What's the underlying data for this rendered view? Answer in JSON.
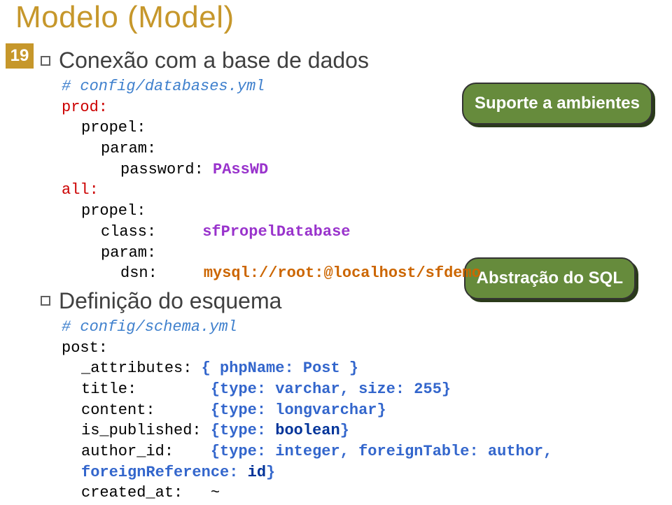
{
  "title": "Modelo (Model)",
  "slide_number": "19",
  "section1_heading": "Conexão com a base de dados",
  "section2_heading": "Definição do esquema",
  "callout1": "Suporte a ambientes",
  "callout2": "Abstração do SQL",
  "code1": {
    "comment": "# config/databases.yml",
    "prod": "prod:",
    "propel1": "propel:",
    "param1": "param:",
    "password_k": "password:",
    "password_v": "PAssWD",
    "all": "all:",
    "propel2": "propel:",
    "class_k": "class:",
    "class_v": "sfPropelDatabase",
    "param2": "param:",
    "dsn_k": "dsn:",
    "dsn_v": "mysql://root:@localhost/sfdemo"
  },
  "code2": {
    "comment": "# config/schema.yml",
    "post": "post:",
    "attrs_k": "_attributes:",
    "attrs_v": "{ phpName: Post }",
    "title_k": "title:",
    "title_v": "{type: varchar, size: 255}",
    "content_k": "content:",
    "content_v": "{type: longvarchar}",
    "ispub_k": "is_published:",
    "ispub_v1": "{type: ",
    "ispub_v2": "boolean",
    "ispub_v3": "}",
    "author_k": "author_id:",
    "author_v1": "{type: integer, foreignTable: author, foreignReference: ",
    "author_v2": "id",
    "author_v3": "}",
    "created_k": "created_at:",
    "created_v": "~"
  }
}
